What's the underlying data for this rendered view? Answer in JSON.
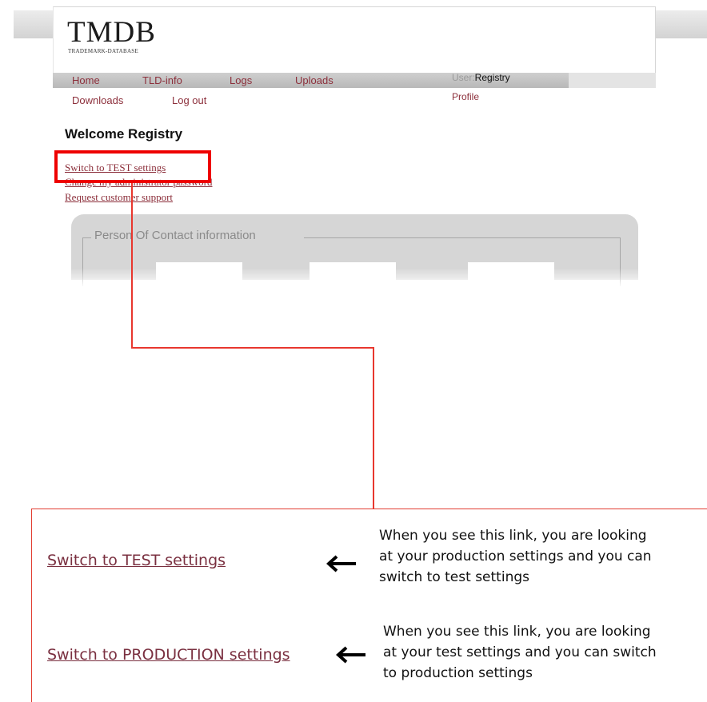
{
  "header": {
    "logo": "TMDB",
    "logo_subtitle": "TRADEMARK-DATABASE"
  },
  "nav": {
    "items": [
      "Home",
      "TLD-info",
      "Logs",
      "Uploads",
      "Downloads",
      "Log out"
    ],
    "user_label": "User:",
    "user_value": "Registry",
    "profile": "Profile"
  },
  "main": {
    "welcome": "Welcome Registry",
    "links": [
      "Switch to TEST settings",
      "Change my administrator password",
      "Request customer support"
    ],
    "panel_legend": "Person Of Contact information"
  },
  "callout": {
    "test_link": "Switch to TEST settings",
    "test_explain": [
      "When you see this link, you are looking",
      "at your production settings and you can",
      "switch to test settings"
    ],
    "prod_link": "Switch to PRODUCTION settings",
    "prod_explain": [
      "When you see this link, you are looking",
      "at your test settings and you can switch",
      "to production settings"
    ]
  },
  "colors": {
    "link": "#8c2f3b",
    "highlight": "#ee0000"
  }
}
